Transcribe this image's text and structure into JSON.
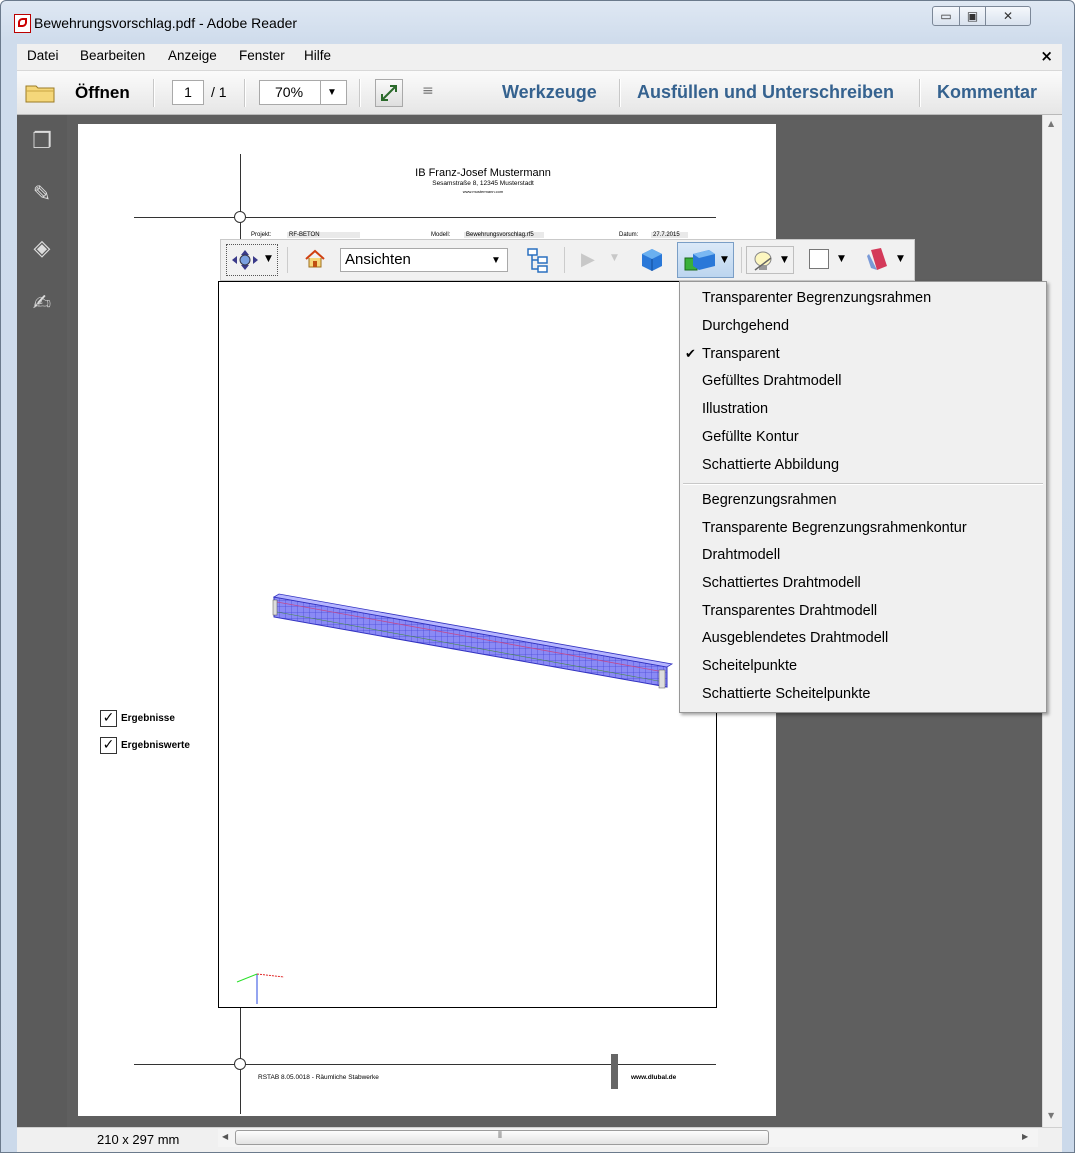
{
  "window": {
    "title": "Bewehrungsvorschlag.pdf - Adobe Reader",
    "controls": {
      "minimize": "▭",
      "maximize": "▣",
      "close": "✕"
    }
  },
  "menubar": {
    "items": [
      "Datei",
      "Bearbeiten",
      "Anzeige",
      "Fenster",
      "Hilfe"
    ],
    "close": "×"
  },
  "toolbar": {
    "open_label": "Öffnen",
    "page_current": "1",
    "page_total": "/ 1",
    "zoom": "70%",
    "tools_label": "Werkzeuge",
    "fill_sign_label": "Ausfüllen und Unterschreiben",
    "comment_label": "Kommentar"
  },
  "document": {
    "header_title": "IB Franz-Josef Mustermann",
    "header_address": "Sesamstraße 8, 12345 Musterstadt",
    "header_web": "www.mustermann.com",
    "projekt_label": "Projekt:",
    "projekt_value": "RF-BETON",
    "modell_label": "Modell:",
    "modell_value": "Bewehrungsvorschlag.rf5",
    "datum_label": "Datum:",
    "datum_value": "27.7.2015",
    "footer_left": "RSTAB 8.05.0018 - Räumliche Stabwerke",
    "footer_right": "www.dlubal.de",
    "checkboxes": [
      {
        "label": "Ergebnisse",
        "checked": true
      },
      {
        "label": "Ergebniswerte",
        "checked": true
      }
    ]
  },
  "toolbar3d": {
    "views_label": "Ansichten"
  },
  "render_menu": {
    "group1": [
      {
        "label": "Transparenter Begrenzungsrahmen",
        "checked": false
      },
      {
        "label": "Durchgehend",
        "checked": false
      },
      {
        "label": "Transparent",
        "checked": true
      },
      {
        "label": "Gefülltes Drahtmodell",
        "checked": false
      },
      {
        "label": "Illustration",
        "checked": false
      },
      {
        "label": "Gefüllte Kontur",
        "checked": false
      },
      {
        "label": "Schattierte Abbildung",
        "checked": false
      }
    ],
    "group2": [
      {
        "label": "Begrenzungsrahmen"
      },
      {
        "label": "Transparente Begrenzungsrahmenkontur"
      },
      {
        "label": "Drahtmodell"
      },
      {
        "label": "Schattiertes Drahtmodell"
      },
      {
        "label": "Transparentes Drahtmodell"
      },
      {
        "label": "Ausgeblendetes Drahtmodell"
      },
      {
        "label": "Scheitelpunkte"
      },
      {
        "label": "Schattierte Scheitelpunkte"
      }
    ]
  },
  "statusbar": {
    "page_size": "210 x 297 mm"
  },
  "colors": {
    "link": "#35628f",
    "rail": "#5b5b5b",
    "docbg": "#5f5f5f",
    "beam": "#6a6af0"
  }
}
